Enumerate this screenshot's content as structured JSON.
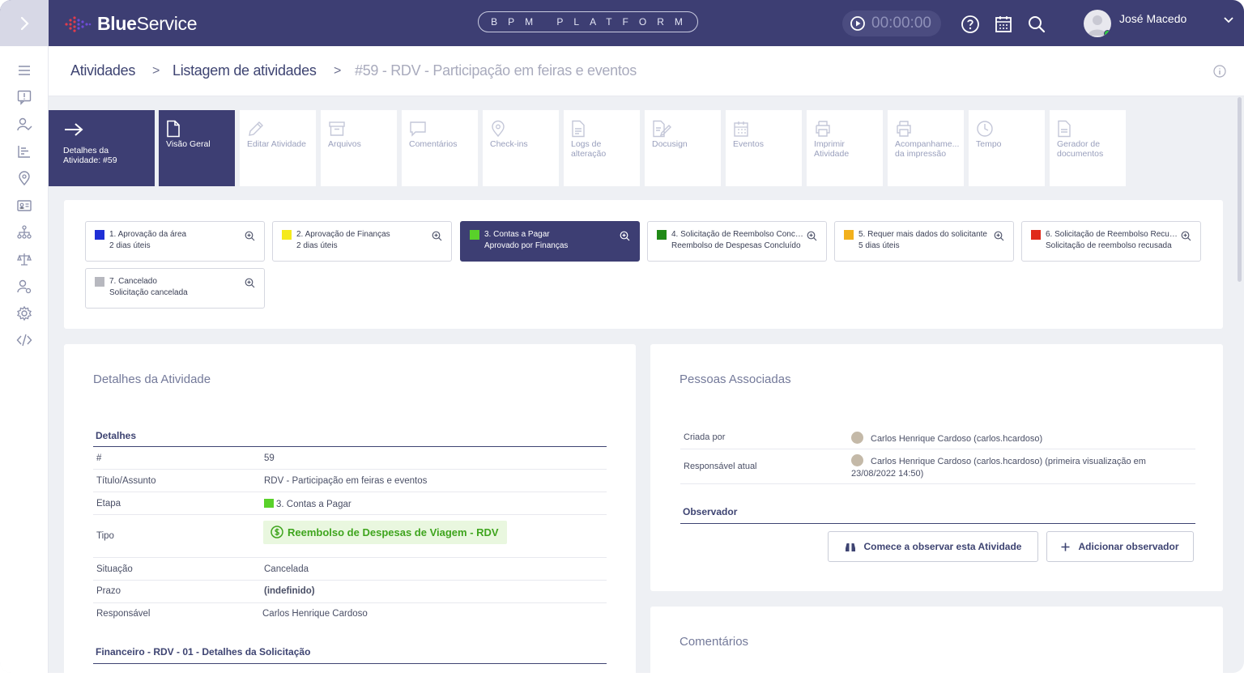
{
  "header": {
    "logo_bold": "Blue",
    "logo_regular": "Service",
    "platform_label": "BPM PLATFORM",
    "timer": "00:00:00",
    "user_name": "José Macedo"
  },
  "breadcrumb": {
    "items": [
      "Atividades",
      "Listagem de atividades"
    ],
    "current": "#59 - RDV - Participação em feiras e eventos",
    "separator": ">"
  },
  "tabs": [
    {
      "l1": "Detalhes da",
      "l2": "Atividade: #59",
      "icon": "arrow-right-icon"
    },
    {
      "l1": "Visão Geral",
      "l2": "",
      "icon": "document-icon"
    },
    {
      "l1": "Editar Atividade",
      "l2": "",
      "icon": "pencil-icon"
    },
    {
      "l1": "Arquivos",
      "l2": "",
      "icon": "archive-icon"
    },
    {
      "l1": "Comentários",
      "l2": "",
      "icon": "comment-icon"
    },
    {
      "l1": "Check-ins",
      "l2": "",
      "icon": "map-pin-icon"
    },
    {
      "l1": "Logs de",
      "l2": "alteração",
      "icon": "file-log-icon"
    },
    {
      "l1": "Docusign",
      "l2": "",
      "icon": "docusign-icon"
    },
    {
      "l1": "Eventos",
      "l2": "",
      "icon": "calendar-icon"
    },
    {
      "l1": "Imprimir",
      "l2": "Atividade",
      "icon": "printer-icon"
    },
    {
      "l1": "Acompanhame...",
      "l2": "da impressão",
      "icon": "printer-icon"
    },
    {
      "l1": "Tempo",
      "l2": "",
      "icon": "clock-icon"
    },
    {
      "l1": "Gerador de",
      "l2": "documentos",
      "icon": "file-icon"
    }
  ],
  "stages": [
    {
      "l1": "1. Aprovação da área",
      "l2": "2 dias úteis",
      "color": "#1f2fd6"
    },
    {
      "l1": "2. Aprovação de Finanças",
      "l2": "2 dias úteis",
      "color": "#f5ea1c"
    },
    {
      "l1": "3. Contas a Pagar",
      "l2": "Aprovado por Finanças",
      "color": "#59d12a"
    },
    {
      "l1": "4. Solicitação de Reembolso Concl...",
      "l2": "Reembolso de Despesas Concluído",
      "color": "#208a16"
    },
    {
      "l1": "5. Requer mais dados do solicitante",
      "l2": "5 dias úteis",
      "color": "#f2b01c"
    },
    {
      "l1": "6. Solicitação de Reembolso Recus...",
      "l2": "Solicitação de reembolso recusada",
      "color": "#e02a1b"
    },
    {
      "l1": "7. Cancelado",
      "l2": "Solicitação cancelada",
      "color": "#b7b8bf"
    }
  ],
  "details": {
    "title": "Detalhes da Atividade",
    "group": "Detalhes",
    "rows": [
      {
        "k": "#",
        "v": "59"
      },
      {
        "k": "Título/Assunto",
        "v": "RDV - Participação em feiras e eventos"
      },
      {
        "k": "Etapa",
        "v": "3. Contas a Pagar"
      },
      {
        "k": "Tipo",
        "v": "Reembolso de Despesas de Viagem - RDV"
      },
      {
        "k": "Situação",
        "v": "Cancelada"
      },
      {
        "k": "Prazo",
        "v": "(indefinido)"
      },
      {
        "k": "Responsável",
        "v": "Carlos Henrique Cardoso"
      }
    ],
    "group2": "Financeiro - RDV - 01 - Detalhes da Solicitação"
  },
  "people": {
    "title": "Pessoas Associadas",
    "created_by_label": "Criada por",
    "created_by": "Carlos Henrique Cardoso (carlos.hcardoso)",
    "responsible_label": "Responsável atual",
    "responsible": "Carlos Henrique Cardoso (carlos.hcardoso)  (primeira visualização em",
    "responsible_date": "23/08/2022 14:50)",
    "observer_head": "Observador",
    "observe_btn": "Comece a observar esta Atividade",
    "add_observer_btn": "Adicionar observador"
  },
  "comments": {
    "title": "Comentários"
  },
  "colors": {
    "navy": "#3d3e73",
    "accent_green": "#59d12a"
  }
}
